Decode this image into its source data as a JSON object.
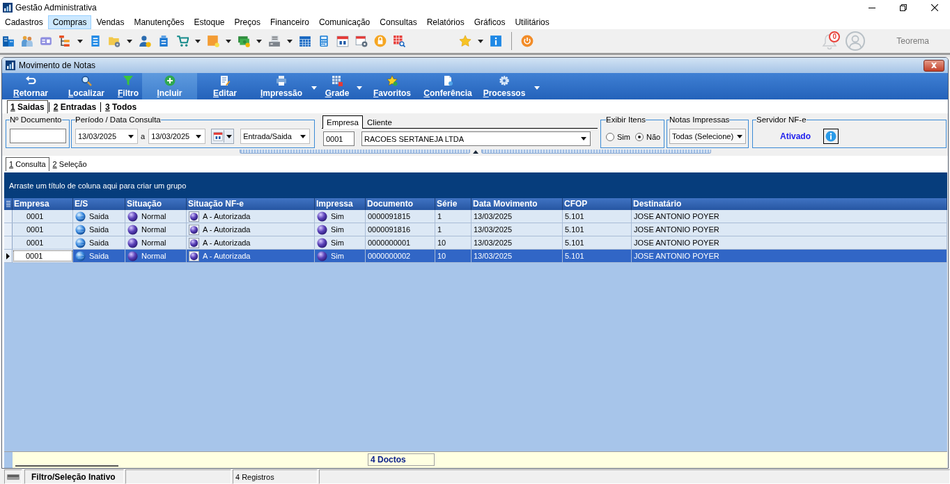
{
  "window": {
    "title": "Gestão Administrativa"
  },
  "menu": [
    {
      "label": "Cadastros",
      "selected": false
    },
    {
      "label": "Compras",
      "selected": true
    },
    {
      "label": "Vendas",
      "selected": false
    },
    {
      "label": "Manutenções",
      "selected": false
    },
    {
      "label": "Estoque",
      "selected": false
    },
    {
      "label": "Preços",
      "selected": false
    },
    {
      "label": "Financeiro",
      "selected": false
    },
    {
      "label": "Comunicação",
      "selected": false
    },
    {
      "label": "Consultas",
      "selected": false
    },
    {
      "label": "Relatórios",
      "selected": false
    },
    {
      "label": "Gráficos",
      "selected": false
    },
    {
      "label": "Utilitários",
      "selected": false
    }
  ],
  "notifications": {
    "count": "0"
  },
  "user": {
    "name": "Teorema"
  },
  "child_window": {
    "title": "Movimento de Notas"
  },
  "actions": [
    {
      "label": "Retornar",
      "highlighted": false,
      "dropdown": false
    },
    {
      "label": "Localizar",
      "highlighted": false,
      "dropdown": false
    },
    {
      "label": "Filtro",
      "highlighted": false,
      "dropdown": false
    },
    {
      "label": "Incluir",
      "highlighted": true,
      "dropdown": false
    },
    {
      "label": "Editar",
      "highlighted": false,
      "dropdown": false
    },
    {
      "label": "Impressão",
      "highlighted": false,
      "dropdown": true
    },
    {
      "label": "Grade",
      "highlighted": false,
      "dropdown": true
    },
    {
      "label": "Favoritos",
      "highlighted": false,
      "dropdown": false
    },
    {
      "label": "Conferência",
      "highlighted": false,
      "dropdown": false
    },
    {
      "label": "Processos",
      "highlighted": false,
      "dropdown": true
    }
  ],
  "direction_tabs": [
    {
      "label": "1 Saidas",
      "selected": true
    },
    {
      "label": "2 Entradas",
      "selected": false
    },
    {
      "label": "3 Todos",
      "selected": false
    }
  ],
  "filters": {
    "document": {
      "label": "Nº Documento"
    },
    "period": {
      "label": "Período / Data Consulta",
      "from": "13/03/2025",
      "separator": "a",
      "to": "13/03/2025",
      "movement": "Entrada/Saida"
    },
    "partner": {
      "tabs": [
        {
          "label": "Empresa",
          "selected": true
        },
        {
          "label": "Cliente",
          "selected": false
        }
      ],
      "company": "0001",
      "client": "RACOES SERTANEJA LTDA"
    },
    "show_items": {
      "label": "Exibir Itens",
      "options": [
        {
          "label": "Sim",
          "selected": false
        },
        {
          "label": "Não",
          "selected": true
        }
      ]
    },
    "printed_notes": {
      "label": "Notas Impressas",
      "value": "Todas (Selecione)"
    },
    "nfe_server": {
      "label": "Servidor NF-e",
      "status": "Ativado"
    }
  },
  "view_tabs": [
    {
      "label": "1 Consulta",
      "selected": true
    },
    {
      "label": "2 Seleção",
      "selected": false
    }
  ],
  "grid": {
    "group_hint": "Arraste um título de coluna aqui para criar um grupo",
    "columns": [
      {
        "label": "Empresa",
        "kind": "code"
      },
      {
        "label": "E/S",
        "kind": "direction"
      },
      {
        "label": "Situação",
        "kind": "status"
      },
      {
        "label": "Situação NF-e",
        "kind": "nfe_status"
      },
      {
        "label": "Impressa",
        "kind": "status"
      },
      {
        "label": "Documento",
        "kind": "text"
      },
      {
        "label": "Série",
        "kind": "text"
      },
      {
        "label": "Data Movimento",
        "kind": "text"
      },
      {
        "label": "CFOP",
        "kind": "text"
      },
      {
        "label": "Destinatário",
        "kind": "text"
      }
    ],
    "rows": [
      {
        "selected": false,
        "cells": [
          "0001",
          "Saida",
          "Normal",
          "A - Autorizada",
          "Sim",
          "0000091815",
          "1",
          "13/03/2025",
          "5.101",
          "JOSE ANTONIO POYER"
        ]
      },
      {
        "selected": false,
        "cells": [
          "0001",
          "Saida",
          "Normal",
          "A - Autorizada",
          "Sim",
          "0000091816",
          "1",
          "13/03/2025",
          "5.101",
          "JOSE ANTONIO POYER"
        ]
      },
      {
        "selected": false,
        "cells": [
          "0001",
          "Saida",
          "Normal",
          "A - Autorizada",
          "Sim",
          "0000000001",
          "10",
          "13/03/2025",
          "5.101",
          "JOSE ANTONIO POYER"
        ]
      },
      {
        "selected": true,
        "cells": [
          "0001",
          "Saida",
          "Normal",
          "A - Autorizada",
          "Sim",
          "0000000002",
          "10",
          "13/03/2025",
          "5.101",
          "JOSE ANTONIO POYER"
        ]
      }
    ]
  },
  "footer": {
    "total": "4 Doctos"
  },
  "status_bar": {
    "filter": "Filtro/Seleção Inativo",
    "records": "4 Registros"
  }
}
